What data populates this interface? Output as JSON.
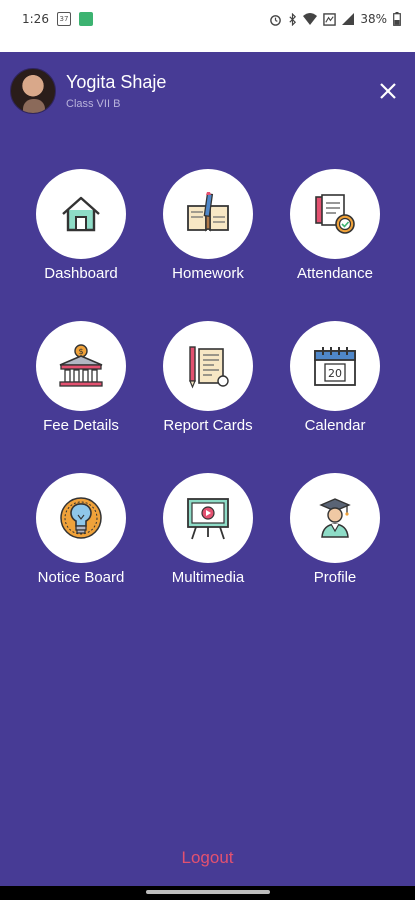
{
  "status_bar": {
    "time": "1:26",
    "notif_calendar_num": "37",
    "battery_percent": "38%",
    "icons": [
      "alarm-icon",
      "bluetooth-icon",
      "wifi-icon",
      "data-saver-icon",
      "signal-icon",
      "battery-icon"
    ]
  },
  "profile": {
    "name": "Yogita Shaje",
    "class_label": "Class VII B"
  },
  "menu": {
    "items": [
      {
        "label": "Dashboard",
        "icon": "house-icon"
      },
      {
        "label": "Homework",
        "icon": "book-icon"
      },
      {
        "label": "Attendance",
        "icon": "attendance-icon"
      },
      {
        "label": "Fee Details",
        "icon": "bank-icon"
      },
      {
        "label": "Report Cards",
        "icon": "report-card-icon"
      },
      {
        "label": "Calendar",
        "icon": "calendar-icon"
      },
      {
        "label": "Notice Board",
        "icon": "lightbulb-icon"
      },
      {
        "label": "Multimedia",
        "icon": "presentation-board-icon"
      },
      {
        "label": "Profile",
        "icon": "graduate-icon"
      }
    ],
    "calendar_day": "20"
  },
  "logout_label": "Logout",
  "colors": {
    "drawer_bg": "#473b95",
    "logout": "#e35170",
    "accent_teal": "#8edcc7",
    "accent_orange": "#f0a23a"
  }
}
